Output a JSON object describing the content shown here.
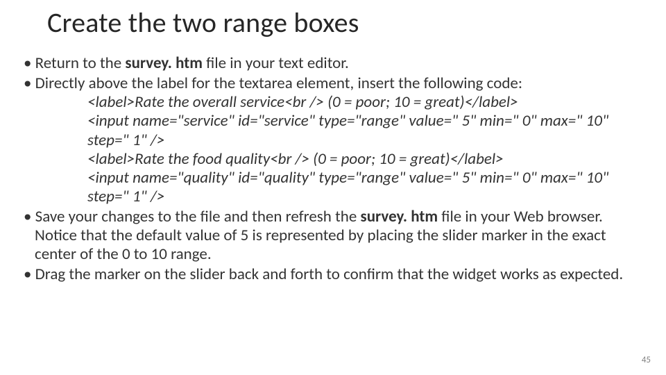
{
  "title": "Create the two range boxes",
  "bullets": {
    "b1a": "Return to the ",
    "b1file": "survey. htm",
    "b1b": " file in your text editor.",
    "b2": "Directly above the label for the textarea element, insert the following code:",
    "code1": "<label>Rate the overall service<br /> (0 = poor; 10 = great)</label>",
    "code2": "<input name=\"service\" id=\"service\" type=\"range\" value=\" 5\" min=\" 0\" max=\" 10\" step=\" 1\" />",
    "code3": "<label>Rate the food quality<br /> (0 = poor; 10 = great)</label>",
    "code4": "<input name=\"quality\" id=\"quality\" type=\"range\" value=\" 5\" min=\" 0\" max=\" 10\" step=\" 1\" />",
    "b3a": "Save your changes to the file and then refresh the ",
    "b3file": "survey. htm",
    "b3b": " file in your Web browser. Notice that the default value of 5 is represented by placing the slider marker in the exact center of the 0 to 10 range.",
    "b4": "Drag the marker on the slider back and forth to confirm that the widget works as expected."
  },
  "page_number": "45"
}
